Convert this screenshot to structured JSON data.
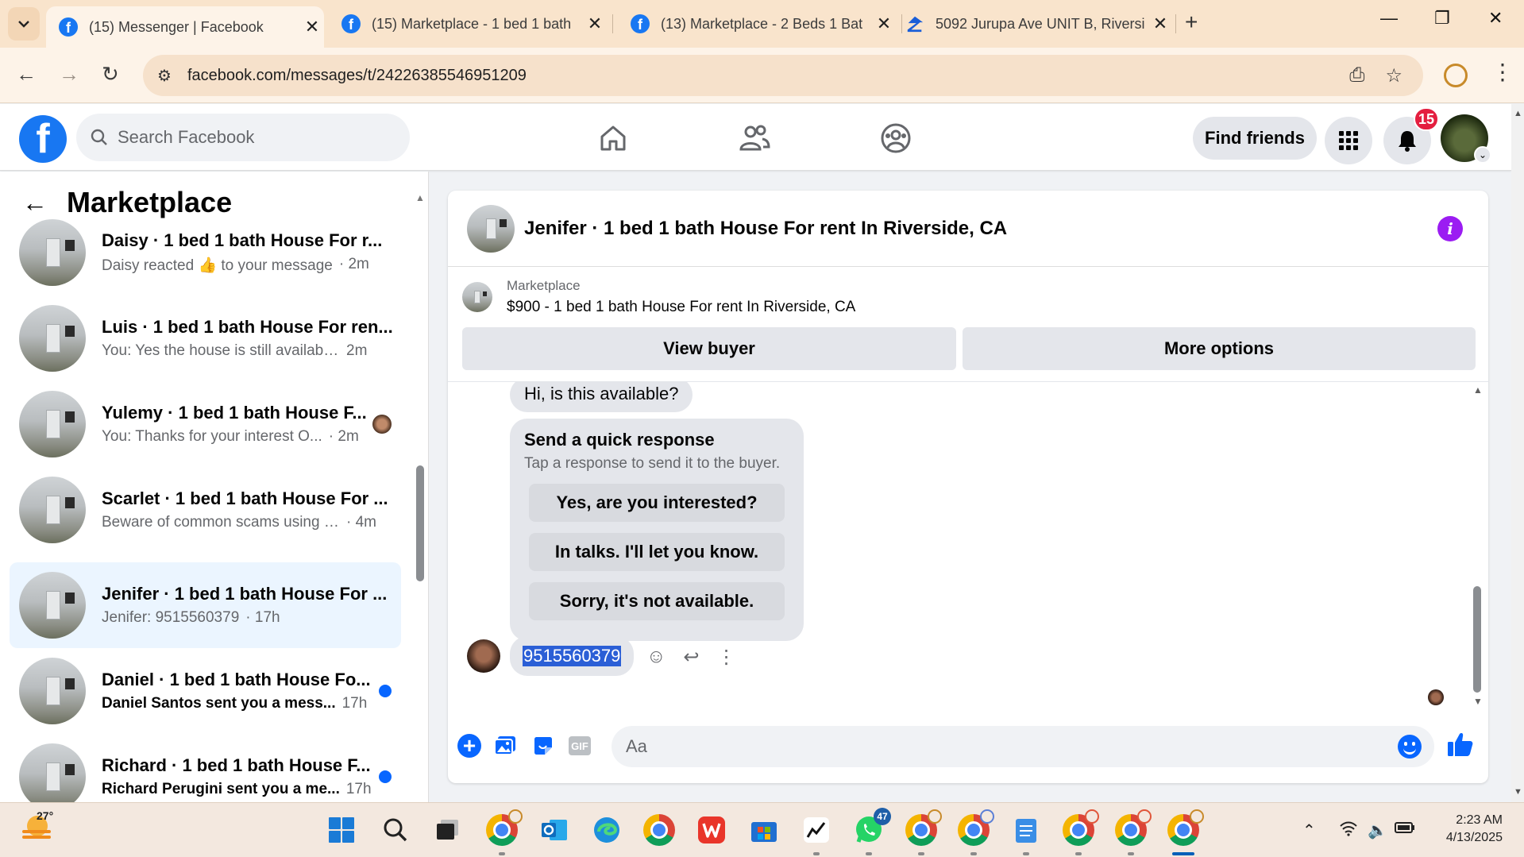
{
  "browser": {
    "tabs": [
      {
        "title": "(15) Messenger | Facebook",
        "icon": "facebook-icon",
        "active": true
      },
      {
        "title": "(15) Marketplace - 1 bed 1 bath",
        "icon": "facebook-icon",
        "active": false
      },
      {
        "title": "(13) Marketplace - 2 Beds 1 Bat",
        "icon": "facebook-icon",
        "active": false
      },
      {
        "title": "5092 Jurupa Ave UNIT B, Riversi",
        "icon": "zillow-icon",
        "active": false
      }
    ],
    "url": "facebook.com/messages/t/24226385546951209"
  },
  "fb_header": {
    "search_placeholder": "Search Facebook",
    "find_friends": "Find friends",
    "notification_count": "15"
  },
  "sidebar": {
    "title": "Marketplace",
    "conversations": [
      {
        "name": "Daisy · 1 bed 1 bath House For r...",
        "snippet": "Daisy reacted 👍 to your message",
        "time": "· 2m",
        "unread": false,
        "selected": false
      },
      {
        "name": "Luis · 1 bed 1 bath House For ren...",
        "snippet": "You: Yes the house is still available ...",
        "time": "2m",
        "unread": false,
        "selected": false
      },
      {
        "name": "Yulemy · 1 bed 1 bath House F...",
        "snippet": "You: Thanks for your interest O...",
        "time": "· 2m",
        "unread": false,
        "selected": false,
        "seen_avatar": true
      },
      {
        "name": "Scarlet · 1 bed 1 bath House For ...",
        "snippet": "Beware of common scams using p...",
        "time": "· 4m",
        "unread": false,
        "selected": false
      },
      {
        "name": "Jenifer · 1 bed 1 bath House For ...",
        "snippet": "Jenifer: 9515560379",
        "time": "· 17h",
        "unread": false,
        "selected": true
      },
      {
        "name": "Daniel · 1 bed 1 bath House Fo...",
        "snippet": "Daniel Santos sent you a mess...",
        "time": "17h",
        "unread": true,
        "selected": false
      },
      {
        "name": "Richard · 1 bed 1 bath House F...",
        "snippet": "Richard Perugini sent you a me...",
        "time": "17h",
        "unread": true,
        "selected": false
      }
    ]
  },
  "chat": {
    "title": "Jenifer · 1 bed 1 bath House For rent In Riverside, CA",
    "listing_label": "Marketplace",
    "listing_price_title": "$900 - 1 bed 1 bath House For rent In Riverside, CA",
    "view_buyer": "View buyer",
    "more_options": "More options",
    "first_message": "Hi, is this available?",
    "quick_response": {
      "title": "Send a quick response",
      "subtitle": "Tap a response to send it to the buyer.",
      "options": [
        "Yes, are you interested?",
        "In talks. I'll let you know.",
        "Sorry, it's not available."
      ]
    },
    "phone_message": "9515560379",
    "composer_placeholder": "Aa"
  },
  "taskbar": {
    "temperature": "27°",
    "whatsapp_badge": "47",
    "time": "2:23 AM",
    "date": "4/13/2025"
  },
  "colors": {
    "fb_blue": "#1877f2",
    "messenger_blue": "#0866ff",
    "selected_row": "#ebf5ff",
    "info_purple": "#9b1cf2",
    "badge_red": "#e41e3f"
  }
}
